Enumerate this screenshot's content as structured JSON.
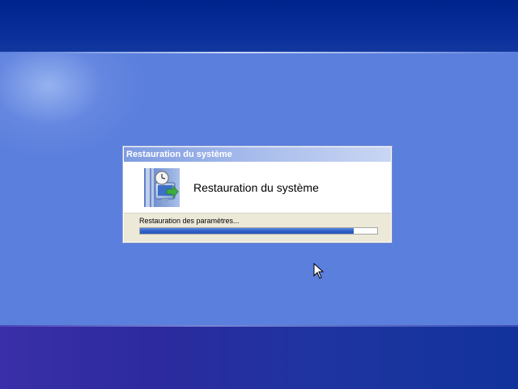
{
  "dialog": {
    "title": "Restauration du système",
    "header_title": "Restauration du système",
    "status": "Restauration des paramètres...",
    "progress_fraction": 0.9
  },
  "icons": {
    "header": "system-restore-icon",
    "cursor": "mouse-pointer-icon"
  },
  "colors": {
    "desktop": "#5b7fdd",
    "top_band": "#0a2f9c",
    "bottom_band": "#2c2a9e",
    "progress": "#2f5fc7",
    "dialog_bg": "#ece9d8"
  }
}
